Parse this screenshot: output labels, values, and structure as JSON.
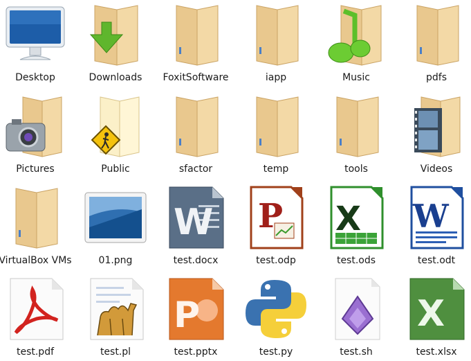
{
  "items": [
    {
      "label": "Desktop",
      "icon": "desktop-icon"
    },
    {
      "label": "Downloads",
      "icon": "downloads-folder-icon"
    },
    {
      "label": "FoxitSoftware",
      "icon": "folder-icon"
    },
    {
      "label": "iapp",
      "icon": "folder-icon"
    },
    {
      "label": "Music",
      "icon": "music-folder-icon"
    },
    {
      "label": "pdfs",
      "icon": "folder-icon"
    },
    {
      "label": "Pictures",
      "icon": "pictures-folder-icon"
    },
    {
      "label": "Public",
      "icon": "public-folder-icon"
    },
    {
      "label": "sfactor",
      "icon": "folder-icon"
    },
    {
      "label": "temp",
      "icon": "folder-icon"
    },
    {
      "label": "tools",
      "icon": "folder-icon"
    },
    {
      "label": "Videos",
      "icon": "videos-folder-icon"
    },
    {
      "label": "VirtualBox VMs",
      "icon": "folder-icon"
    },
    {
      "label": "01.png",
      "icon": "image-file-icon"
    },
    {
      "label": "test.docx",
      "icon": "word-docx-icon"
    },
    {
      "label": "test.odp",
      "icon": "presentation-odp-icon"
    },
    {
      "label": "test.ods",
      "icon": "spreadsheet-ods-icon"
    },
    {
      "label": "test.odt",
      "icon": "text-odt-icon"
    },
    {
      "label": "test.pdf",
      "icon": "pdf-file-icon"
    },
    {
      "label": "test.pl",
      "icon": "perl-script-icon"
    },
    {
      "label": "test.pptx",
      "icon": "powerpoint-pptx-icon"
    },
    {
      "label": "test.py",
      "icon": "python-file-icon"
    },
    {
      "label": "test.sh",
      "icon": "shell-script-icon"
    },
    {
      "label": "test.xlsx",
      "icon": "excel-xlsx-icon"
    }
  ]
}
